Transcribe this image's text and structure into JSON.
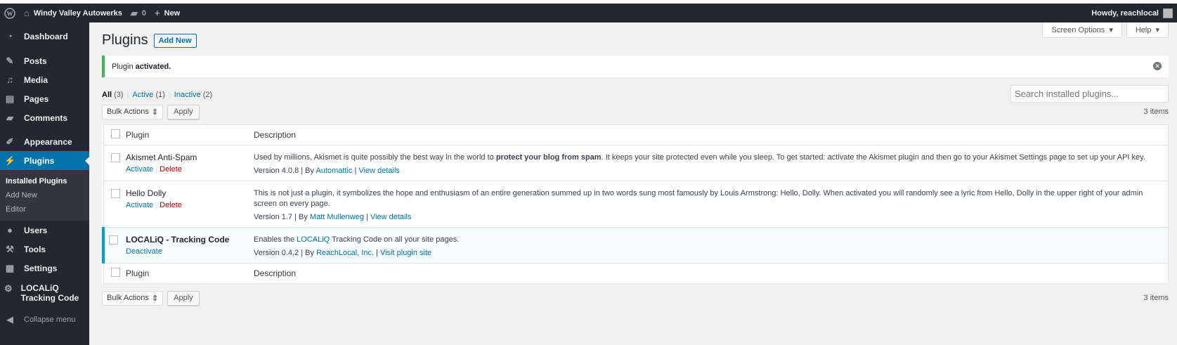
{
  "adminbar": {
    "site_name": "Windy Valley Autowerks",
    "comments_count": "0",
    "new_label": "New",
    "howdy": "Howdy, reachlocal"
  },
  "sidebar": {
    "items": [
      {
        "label": "Dashboard",
        "icon": "dashboard-icon"
      },
      {
        "label": "Posts",
        "icon": "pin-icon"
      },
      {
        "label": "Media",
        "icon": "media-icon"
      },
      {
        "label": "Pages",
        "icon": "pages-icon"
      },
      {
        "label": "Comments",
        "icon": "comment-icon"
      },
      {
        "label": "Appearance",
        "icon": "brush-icon"
      },
      {
        "label": "Plugins",
        "icon": "plugin-icon"
      },
      {
        "label": "Users",
        "icon": "user-icon"
      },
      {
        "label": "Tools",
        "icon": "wrench-icon"
      },
      {
        "label": "Settings",
        "icon": "settings-icon"
      },
      {
        "label": "LOCALiQ Tracking Code",
        "icon": "gear-icon"
      }
    ],
    "submenu": [
      "Installed Plugins",
      "Add New",
      "Editor"
    ],
    "collapse": "Collapse menu"
  },
  "screen_meta": {
    "screen_options": "Screen Options",
    "help": "Help"
  },
  "page": {
    "title": "Plugins",
    "add_new": "Add New",
    "notice_prefix": "Plugin",
    "notice_bold": "activated."
  },
  "filters": {
    "all": "All",
    "all_count": "(3)",
    "active": "Active",
    "active_count": "(1)",
    "inactive": "Inactive",
    "inactive_count": "(2)",
    "sep": "|"
  },
  "search": {
    "placeholder": "Search installed plugins..."
  },
  "tablenav": {
    "bulk_actions": "Bulk Actions",
    "apply": "Apply",
    "items": "3 items"
  },
  "table": {
    "col_plugin": "Plugin",
    "col_description": "Description",
    "rows": [
      {
        "name": "Akismet Anti-Spam",
        "action1": "Activate",
        "action2": "Delete",
        "desc_before": "Used by millions, Akismet is quite possibly the best way in the world to ",
        "desc_bold": "protect your blog from spam",
        "desc_after": ". It keeps your site protected even while you sleep. To get started: activate the Akismet plugin and then go to your Akismet Settings page to set up your API key.",
        "version": "Version 4.0.8 | By ",
        "author": "Automattic",
        "link": "View details"
      },
      {
        "name": "Hello Dolly",
        "action1": "Activate",
        "action2": "Delete",
        "desc": "This is not just a plugin, it symbolizes the hope and enthusiasm of an entire generation summed up in two words sung most famously by Louis Armstrong: Hello, Dolly. When activated you will randomly see a lyric from Hello, Dolly in the upper right of your admin screen on every page.",
        "version": "Version 1.7 | By ",
        "author": "Matt Mullenweg",
        "link": "View details"
      },
      {
        "name": "LOCALiQ - Tracking Code",
        "action1": "Deactivate",
        "desc_before": "Enables the ",
        "desc_link": "LOCALiQ",
        "desc_after": " Tracking Code on all your site pages.",
        "version": "Version 0.4.2 | By ",
        "author": "ReachLocal, Inc.",
        "link": "Visit plugin site"
      }
    ]
  },
  "colors": {
    "adminbar": "#23282d",
    "current_menu": "#0073aa",
    "link": "#0073aa",
    "notice": "#46b450",
    "active_border": "#00a0d2"
  }
}
